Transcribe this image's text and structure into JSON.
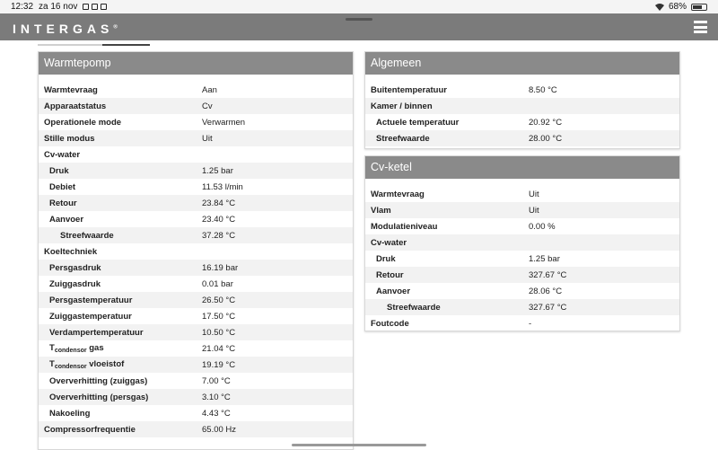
{
  "statusbar": {
    "time": "12:32",
    "date": "za 16 nov",
    "battery": "68%"
  },
  "header": {
    "logo": "INTERGAS",
    "logo_mark": "®"
  },
  "warmtepomp": {
    "title": "Warmtepomp",
    "rows": [
      {
        "label": "Warmtevraag",
        "value": "Aan",
        "level": 0
      },
      {
        "label": "Apparaatstatus",
        "value": "Cv",
        "level": 0
      },
      {
        "label": "Operationele mode",
        "value": "Verwarmen",
        "level": 0
      },
      {
        "label": "Stille modus",
        "value": "Uit",
        "level": 0
      },
      {
        "label": "Cv-water",
        "value": "",
        "level": 0
      },
      {
        "label": "Druk",
        "value": "1.25 bar",
        "level": 1
      },
      {
        "label": "Debiet",
        "value": "11.53 l/min",
        "level": 1
      },
      {
        "label": "Retour",
        "value": "23.84 °C",
        "level": 1
      },
      {
        "label": "Aanvoer",
        "value": "23.40 °C",
        "level": 1
      },
      {
        "label": "Streefwaarde",
        "value": "37.28 °C",
        "level": 2
      },
      {
        "label": "Koeltechniek",
        "value": "",
        "level": 0
      },
      {
        "label": "Persgasdruk",
        "value": "16.19 bar",
        "level": 1
      },
      {
        "label": "Zuiggasdruk",
        "value": "0.01 bar",
        "level": 1
      },
      {
        "label": "Persgastemperatuur",
        "value": "26.50 °C",
        "level": 1
      },
      {
        "label": "Zuiggastemperatuur",
        "value": "17.50 °C",
        "level": 1
      },
      {
        "label": "Verdampertemperatuur",
        "value": "10.50 °C",
        "level": 1
      },
      {
        "label": "T",
        "sub": "condensor",
        "suffix": " gas",
        "value": "21.04 °C",
        "level": 1
      },
      {
        "label": "T",
        "sub": "condensor",
        "suffix": " vloeistof",
        "value": "19.19 °C",
        "level": 1
      },
      {
        "label": "Oververhitting (zuiggas)",
        "value": "7.00 °C",
        "level": 1
      },
      {
        "label": "Oververhitting (persgas)",
        "value": "3.10 °C",
        "level": 1
      },
      {
        "label": "Nakoeling",
        "value": "4.43 °C",
        "level": 1
      },
      {
        "label": "Compressorfrequentie",
        "value": "65.00 Hz",
        "level": 0
      }
    ]
  },
  "algemeen": {
    "title": "Algemeen",
    "rows": [
      {
        "label": "Buitentemperatuur",
        "value": "8.50 °C",
        "level": 0
      },
      {
        "label": "Kamer / binnen",
        "value": "",
        "level": 0
      },
      {
        "label": "Actuele temperatuur",
        "value": "20.92 °C",
        "level": 1
      },
      {
        "label": "Streefwaarde",
        "value": "28.00 °C",
        "level": 1
      }
    ]
  },
  "cvketel": {
    "title": "Cv-ketel",
    "rows": [
      {
        "label": "Warmtevraag",
        "value": "Uit",
        "level": 0
      },
      {
        "label": "Vlam",
        "value": "Uit",
        "level": 0
      },
      {
        "label": "Modulatieniveau",
        "value": "0.00 %",
        "level": 0
      },
      {
        "label": "Cv-water",
        "value": "",
        "level": 0
      },
      {
        "label": "Druk",
        "value": "1.25 bar",
        "level": 1
      },
      {
        "label": "Retour",
        "value": "327.67 °C",
        "level": 1
      },
      {
        "label": "Aanvoer",
        "value": "28.06 °C",
        "level": 1
      },
      {
        "label": "Streefwaarde",
        "value": "327.67 °C",
        "level": 2
      },
      {
        "label": "Foutcode",
        "value": "-",
        "level": 0
      }
    ]
  }
}
